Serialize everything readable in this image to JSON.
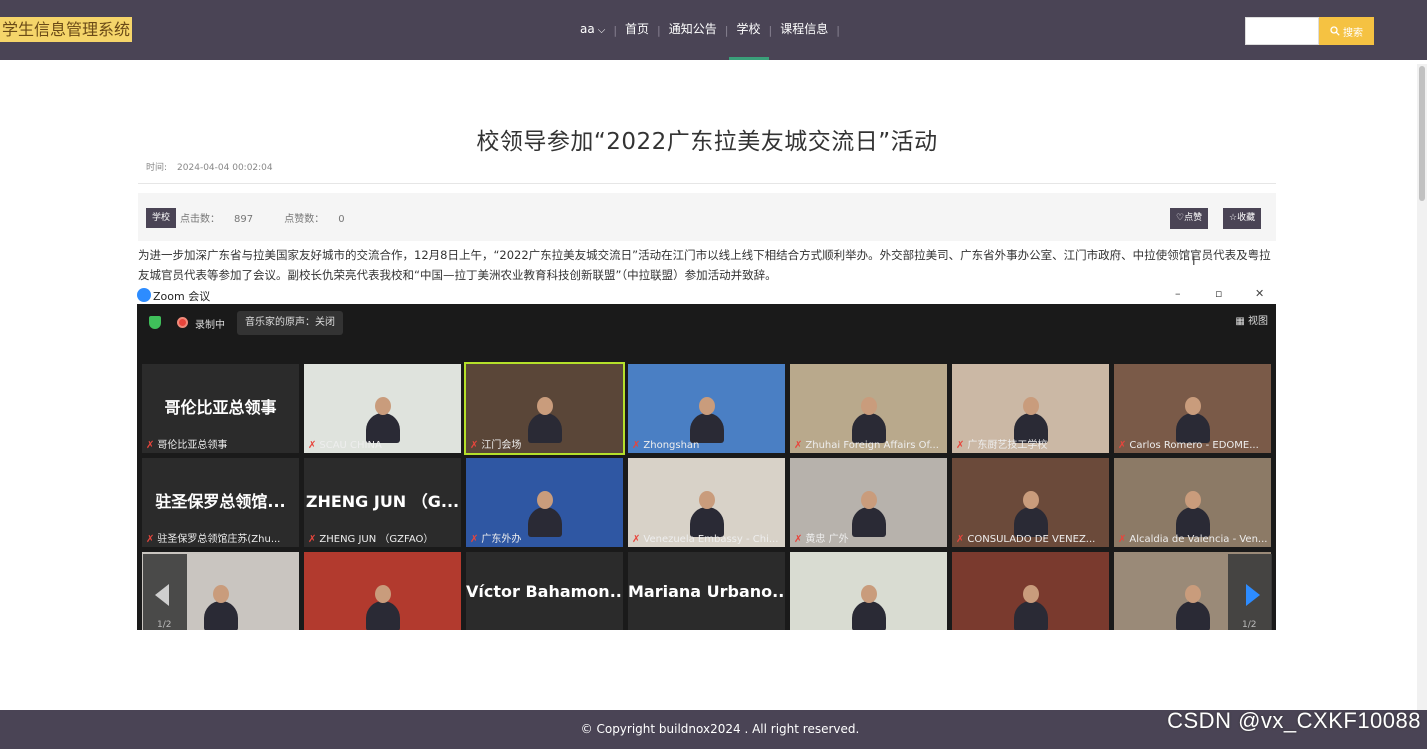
{
  "header": {
    "logo": "学生信息管理系统",
    "user": "aa",
    "nav": [
      "首页",
      "通知公告",
      "学校",
      "课程信息"
    ],
    "active_nav": "学校",
    "search": {
      "placeholder": "",
      "button_label": "搜索"
    }
  },
  "article": {
    "title": "校领导参加“2022广东拉美友城交流日”活动",
    "time_label": "时间:",
    "time_value": "2024-04-04 00:02:04",
    "tag": "学校",
    "clicks_label": "点击数：",
    "clicks_value": "897",
    "likes_label": "点赞数：",
    "likes_value": "0",
    "like_button": "♡点赞",
    "collect_button": "☆收藏",
    "paragraph": "为进一步加深广东省与拉美国家友好城市的交流合作，12月8日上午，“2022广东拉美友城交流日”活动在江门市以线上线下相结合方式顺利举办。外交部拉美司、广东省外事办公室、江门市政府、中拉使领馆官员代表及粤拉友城官员代表等参加了会议。副校长仇荣亮代表我校和“中国—拉丁美洲农业教育科技创新联盟”（中拉联盟）参加活动并致辞。"
  },
  "zoom": {
    "window_title": "Zoom 会议",
    "recording_label": "录制中",
    "audio_pill": "音乐家的原声：关闭",
    "view_button": "视图",
    "page_indicator": "1/2",
    "tiles_row1": [
      {
        "name": "哥伦比亚总领事",
        "big_text": "哥伦比亚总领事",
        "bg": "#2b2b2b"
      },
      {
        "name": "SCAU CHINA",
        "big_text": "",
        "bg": "#dfe3dd"
      },
      {
        "name": "江门会场",
        "big_text": "",
        "bg": "#5a4638"
      },
      {
        "name": "Zhongshan",
        "big_text": "",
        "bg": "#4a7fc4"
      },
      {
        "name": "Zhuhai Foreign Affairs Of...",
        "big_text": "",
        "bg": "#b9a98c"
      },
      {
        "name": "广东厨艺技工学校",
        "big_text": "",
        "bg": "#cbb8a5"
      },
      {
        "name": "Carlos Romero - EDOME...",
        "big_text": "",
        "bg": "#7a5a48"
      }
    ],
    "tiles_row2": [
      {
        "name": "驻圣保罗总领馆庄苏(Zhu...",
        "big_text": "驻圣保罗总领馆...",
        "bg": "#2b2b2b"
      },
      {
        "name": "ZHENG JUN （GZFAO）",
        "big_text": "ZHENG JUN （G...",
        "bg": "#2b2b2b"
      },
      {
        "name": "广东外办",
        "big_text": "",
        "bg": "#2f57a3"
      },
      {
        "name": "Venezuela Embassy - Chi...",
        "big_text": "",
        "bg": "#d8d2c8"
      },
      {
        "name": "黄忠 广外",
        "big_text": "",
        "bg": "#b7b2ac"
      },
      {
        "name": "CONSULADO DE VENEZ...",
        "big_text": "",
        "bg": "#6b4a3a"
      },
      {
        "name": "Alcaldia de Valencia - Ven...",
        "big_text": "",
        "bg": "#8c7a66"
      }
    ],
    "tiles_row3": [
      {
        "name": "",
        "big_text": "",
        "bg": "#c9c5c0"
      },
      {
        "name": "",
        "big_text": "",
        "bg": "#b23a2e"
      },
      {
        "name": "",
        "big_text": "Víctor Bahamon...",
        "bg": "#2b2b2b"
      },
      {
        "name": "",
        "big_text": "Mariana Urbano...",
        "bg": "#2b2b2b"
      },
      {
        "name": "",
        "big_text": "",
        "bg": "#d9dcd2"
      },
      {
        "name": "",
        "big_text": "",
        "bg": "#7a3a2e"
      },
      {
        "name": "",
        "big_text": "",
        "bg": "#9a8a78"
      }
    ]
  },
  "footer": {
    "copyright": "© Copyright buildnox2024 . All right reserved.",
    "watermark": "CSDN @vx_CXKF10088"
  }
}
